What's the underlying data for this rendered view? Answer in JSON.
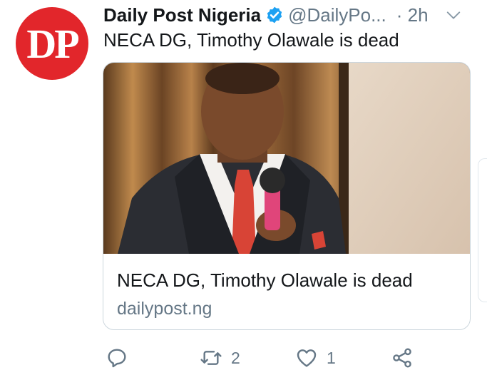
{
  "tweet": {
    "avatar_text": "DP",
    "display_name": "Daily Post Nigeria",
    "handle": "@DailyPo...",
    "time": "· 2h",
    "text": "NECA DG, Timothy Olawale is dead",
    "verified": true
  },
  "card": {
    "title": "NECA DG, Timothy Olawale is dead",
    "domain": "dailypost.ng",
    "image_icon": "photo-of-speaker"
  },
  "actions": {
    "reply_icon": "reply-icon",
    "retweet_icon": "retweet-icon",
    "retweet_count": "2",
    "like_icon": "heart-icon",
    "like_count": "1",
    "share_icon": "share-icon"
  },
  "colors": {
    "brand_red": "#e2262b",
    "verified_blue": "#1da1f2",
    "secondary_text": "#657786",
    "primary_text": "#14171a"
  }
}
